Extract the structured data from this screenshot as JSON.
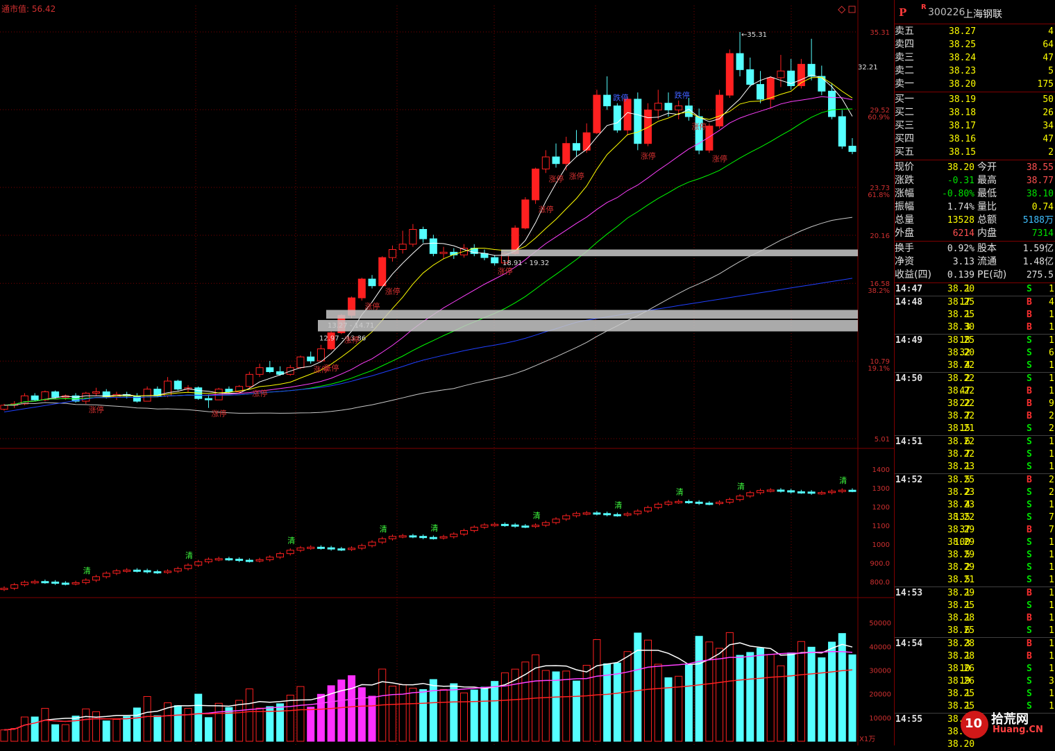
{
  "header": {
    "cap_label": "通市值:",
    "cap_value": "56.42"
  },
  "stock": {
    "p_mark": "P",
    "r_mark": "R",
    "code": "300226",
    "name": "上海钢联"
  },
  "order_book": {
    "asks": [
      {
        "label": "卖五",
        "price": "38.27",
        "vol": "4"
      },
      {
        "label": "卖四",
        "price": "38.25",
        "vol": "64"
      },
      {
        "label": "卖三",
        "price": "38.24",
        "vol": "47"
      },
      {
        "label": "卖二",
        "price": "38.23",
        "vol": "5"
      },
      {
        "label": "卖一",
        "price": "38.20",
        "vol": "175"
      }
    ],
    "bids": [
      {
        "label": "买一",
        "price": "38.19",
        "vol": "50"
      },
      {
        "label": "买二",
        "price": "38.18",
        "vol": "26"
      },
      {
        "label": "买三",
        "price": "38.17",
        "vol": "34"
      },
      {
        "label": "买四",
        "price": "38.16",
        "vol": "47"
      },
      {
        "label": "买五",
        "price": "38.15",
        "vol": "2"
      }
    ]
  },
  "stats": [
    {
      "l1": "现价",
      "v1": "38.20",
      "c1": "#ffff00",
      "l2": "今开",
      "v2": "38.55",
      "c2": "#ff5050"
    },
    {
      "l1": "涨跌",
      "v1": "-0.31",
      "c1": "#00e000",
      "l2": "最高",
      "v2": "38.77",
      "c2": "#ff5050"
    },
    {
      "l1": "涨幅",
      "v1": "-0.80%",
      "c1": "#00e000",
      "l2": "最低",
      "v2": "38.10",
      "c2": "#00e000"
    },
    {
      "l1": "振幅",
      "v1": "1.74%",
      "c1": "#e0e0e0",
      "l2": "量比",
      "v2": "0.74",
      "c2": "#ffff00"
    },
    {
      "l1": "总量",
      "v1": "13528",
      "c1": "#ffff00",
      "l2": "总额",
      "v2": "5188万",
      "c2": "#40c0ff"
    },
    {
      "l1": "外盘",
      "v1": "6214",
      "c1": "#ff5050",
      "l2": "内盘",
      "v2": "7314",
      "c2": "#00e000"
    }
  ],
  "fund": [
    {
      "l1": "换手",
      "v1": "0.92%",
      "c1": "#e0e0e0",
      "l2": "股本",
      "v2": "1.59亿",
      "c2": "#e0e0e0"
    },
    {
      "l1": "净资",
      "v1": "3.13",
      "c1": "#e0e0e0",
      "l2": "流通",
      "v2": "1.48亿",
      "c2": "#e0e0e0"
    },
    {
      "l1": "收益(四)",
      "v1": "0.139",
      "c1": "#e0e0e0",
      "l2": "PE(动)",
      "v2": "275.5",
      "c2": "#e0e0e0"
    }
  ],
  "ticks": [
    {
      "t": "14:47",
      "p": "38.20",
      "v": "1",
      "s": "S",
      "c": "1"
    },
    {
      "t": "14:48",
      "p": "38.25",
      "v": "17",
      "s": "B",
      "c": "4"
    },
    {
      "t": "",
      "p": "38.25",
      "v": "1",
      "s": "B",
      "c": "1"
    },
    {
      "t": "",
      "p": "38.30",
      "v": "3",
      "s": "B",
      "c": "1"
    },
    {
      "t": "14:49",
      "p": "38.25",
      "v": "18",
      "s": "S",
      "c": "1"
    },
    {
      "t": "",
      "p": "38.20",
      "v": "32",
      "s": "S",
      "c": "6"
    },
    {
      "t": "",
      "p": "38.22",
      "v": "4",
      "s": "S",
      "c": "1"
    },
    {
      "t": "14:50",
      "p": "38.22",
      "v": "2",
      "s": "S",
      "c": "1"
    },
    {
      "t": "",
      "p": "38.22",
      "v": "47",
      "s": "B",
      "c": "1"
    },
    {
      "t": "",
      "p": "38.22",
      "v": "22",
      "s": "B",
      "c": "9"
    },
    {
      "t": "",
      "p": "38.22",
      "v": "7",
      "s": "B",
      "c": "2"
    },
    {
      "t": "",
      "p": "38.21",
      "v": "15",
      "s": "S",
      "c": "2"
    },
    {
      "t": "14:51",
      "p": "38.22",
      "v": "6",
      "s": "S",
      "c": "1"
    },
    {
      "t": "",
      "p": "38.22",
      "v": "7",
      "s": "S",
      "c": "1"
    },
    {
      "t": "",
      "p": "38.23",
      "v": "1",
      "s": "S",
      "c": "1"
    },
    {
      "t": "14:52",
      "p": "38.25",
      "v": "5",
      "s": "B",
      "c": "2"
    },
    {
      "t": "",
      "p": "38.23",
      "v": "2",
      "s": "S",
      "c": "2"
    },
    {
      "t": "",
      "p": "38.23",
      "v": "4",
      "s": "S",
      "c": "1"
    },
    {
      "t": "",
      "p": "38.22",
      "v": "135",
      "s": "S",
      "c": "7"
    },
    {
      "t": "",
      "p": "38.29",
      "v": "37",
      "s": "B",
      "c": "7"
    },
    {
      "t": "",
      "p": "38.29",
      "v": "100",
      "s": "S",
      "c": "1"
    },
    {
      "t": "",
      "p": "38.29",
      "v": "5",
      "s": "S",
      "c": "1"
    },
    {
      "t": "",
      "p": "38.29",
      "v": "2",
      "s": "S",
      "c": "1"
    },
    {
      "t": "",
      "p": "38.21",
      "v": "5",
      "s": "S",
      "c": "1"
    },
    {
      "t": "14:53",
      "p": "38.29",
      "v": "1",
      "s": "B",
      "c": "1"
    },
    {
      "t": "",
      "p": "38.25",
      "v": "1",
      "s": "S",
      "c": "1"
    },
    {
      "t": "",
      "p": "38.28",
      "v": "1",
      "s": "B",
      "c": "1"
    },
    {
      "t": "",
      "p": "38.25",
      "v": "6",
      "s": "S",
      "c": "1"
    },
    {
      "t": "14:54",
      "p": "38.28",
      "v": "3",
      "s": "B",
      "c": "1"
    },
    {
      "t": "",
      "p": "38.28",
      "v": "1",
      "s": "B",
      "c": "1"
    },
    {
      "t": "",
      "p": "38.26",
      "v": "10",
      "s": "S",
      "c": "1"
    },
    {
      "t": "",
      "p": "38.26",
      "v": "19",
      "s": "S",
      "c": "3"
    },
    {
      "t": "",
      "p": "38.25",
      "v": "1",
      "s": "S",
      "c": "1"
    },
    {
      "t": "",
      "p": "38.25",
      "v": "1",
      "s": "S",
      "c": "1"
    },
    {
      "t": "14:55",
      "p": "38.25",
      "v": "",
      "s": "",
      "c": ""
    },
    {
      "t": "",
      "p": "38.27",
      "v": "",
      "s": "",
      "c": ""
    },
    {
      "t": "",
      "p": "38.20",
      "v": "",
      "s": "",
      "c": ""
    }
  ],
  "price_axis": {
    "labels": [
      "35.31",
      "32.21",
      "29.52",
      "60.9%",
      "23.73",
      "61.8%",
      "20.16",
      "16.58",
      "38.2%",
      "10.79",
      "19.1%",
      "5.01"
    ]
  },
  "ind_axis": {
    "labels": [
      "1400",
      "1300",
      "1200",
      "1100",
      "1000",
      "900.0",
      "800.0"
    ]
  },
  "vol_axis": {
    "labels": [
      "50000",
      "40000",
      "30000",
      "20000",
      "10000"
    ],
    "unit": "X1万"
  },
  "annotations": {
    "high_marker": "35.31",
    "zones": [
      "18.91 - 19.32",
      "13.27 - 14.71",
      "12.97 - 13.86"
    ],
    "limit_up": "涨停",
    "limit_down": "跌停",
    "clear": "清"
  },
  "colors": {
    "up": "#ff2020",
    "down": "#55ffff",
    "limit_down_fill": "#0000ff",
    "ma5": "#ffffff",
    "ma10": "#ffff00",
    "ma20": "#ff40ff",
    "ma30": "#00ff00",
    "ma60": "#c8c8c8",
    "ma120": "#2040ff",
    "grid": "#800000",
    "axis_text": "#d03030"
  },
  "chart_data": {
    "type": "candlestick",
    "price_range": [
      5.01,
      35.31
    ],
    "candles": [
      [
        7.2,
        7.6,
        7.1,
        7.5
      ],
      [
        7.5,
        7.8,
        7.3,
        7.6
      ],
      [
        7.6,
        8.4,
        7.5,
        8.2
      ],
      [
        8.2,
        8.4,
        7.8,
        7.9
      ],
      [
        7.9,
        8.6,
        7.8,
        8.5
      ],
      [
        8.5,
        8.6,
        8.0,
        8.1
      ],
      [
        8.1,
        8.3,
        7.9,
        8.2
      ],
      [
        8.2,
        8.4,
        7.7,
        7.8
      ],
      [
        7.8,
        8.5,
        7.6,
        8.4
      ],
      [
        8.4,
        8.8,
        8.2,
        8.5
      ],
      [
        8.5,
        8.7,
        8.0,
        8.1
      ],
      [
        8.1,
        8.5,
        7.9,
        8.3
      ],
      [
        8.3,
        8.5,
        8.0,
        8.2
      ],
      [
        8.2,
        8.4,
        7.7,
        7.8
      ],
      [
        7.8,
        8.9,
        7.8,
        8.7
      ],
      [
        8.7,
        8.9,
        8.1,
        8.2
      ],
      [
        8.2,
        9.6,
        8.1,
        9.3
      ],
      [
        9.3,
        9.4,
        8.6,
        8.7
      ],
      [
        8.7,
        9.0,
        8.5,
        8.8
      ],
      [
        8.8,
        8.9,
        7.9,
        8.0
      ],
      [
        8.0,
        8.3,
        7.3,
        7.9
      ],
      [
        7.9,
        8.8,
        7.9,
        8.7
      ],
      [
        8.7,
        8.9,
        8.4,
        8.5
      ],
      [
        8.5,
        9.0,
        8.4,
        8.9
      ],
      [
        8.9,
        10.0,
        8.8,
        9.8
      ],
      [
        9.8,
        10.6,
        9.6,
        10.3
      ],
      [
        10.3,
        10.8,
        9.9,
        10.0
      ],
      [
        10.0,
        10.4,
        9.7,
        9.8
      ],
      [
        9.8,
        10.5,
        9.7,
        10.3
      ],
      [
        10.3,
        11.2,
        10.2,
        11.1
      ],
      [
        11.1,
        11.5,
        10.6,
        10.8
      ],
      [
        10.8,
        12.0,
        10.7,
        11.7
      ],
      [
        11.7,
        13.0,
        11.6,
        12.9
      ],
      [
        12.9,
        14.3,
        12.8,
        14.2
      ],
      [
        14.2,
        15.6,
        14.0,
        15.5
      ],
      [
        15.5,
        17.0,
        15.3,
        16.9
      ],
      [
        16.9,
        17.2,
        16.2,
        16.4
      ],
      [
        16.4,
        18.6,
        16.4,
        18.5
      ],
      [
        18.5,
        19.4,
        18.2,
        19.1
      ],
      [
        19.1,
        20.5,
        18.8,
        19.5
      ],
      [
        19.5,
        21.0,
        19.3,
        20.6
      ],
      [
        20.6,
        20.8,
        19.6,
        19.9
      ],
      [
        19.9,
        20.2,
        18.6,
        18.8
      ],
      [
        18.8,
        19.3,
        18.4,
        18.9
      ],
      [
        18.9,
        19.2,
        18.4,
        18.7
      ],
      [
        18.7,
        19.5,
        18.5,
        19.2
      ],
      [
        19.2,
        19.5,
        18.6,
        18.8
      ],
      [
        18.8,
        19.1,
        18.3,
        18.5
      ],
      [
        18.5,
        18.7,
        17.9,
        18.1
      ],
      [
        18.1,
        18.9,
        18.0,
        18.8
      ],
      [
        18.8,
        20.9,
        18.7,
        20.7
      ],
      [
        20.7,
        23.0,
        20.6,
        22.8
      ],
      [
        22.8,
        25.2,
        22.5,
        25.1
      ],
      [
        25.1,
        26.5,
        24.8,
        26.0
      ],
      [
        26.0,
        27.0,
        25.2,
        25.5
      ],
      [
        25.5,
        27.5,
        25.0,
        27.0
      ],
      [
        27.0,
        28.0,
        26.0,
        26.5
      ],
      [
        26.5,
        28.5,
        26.3,
        27.8
      ],
      [
        27.8,
        31.0,
        27.7,
        30.6
      ],
      [
        30.6,
        32.0,
        29.5,
        29.8
      ],
      [
        29.8,
        30.0,
        27.8,
        28.0
      ],
      [
        28.0,
        30.5,
        27.6,
        30.3
      ],
      [
        30.3,
        30.8,
        26.5,
        27.0
      ],
      [
        27.0,
        30.0,
        26.8,
        29.5
      ],
      [
        29.5,
        31.0,
        28.8,
        30.0
      ],
      [
        30.0,
        30.8,
        29.0,
        29.5
      ],
      [
        29.5,
        30.2,
        28.8,
        29.8
      ],
      [
        29.8,
        30.4,
        28.7,
        29.0
      ],
      [
        29.0,
        29.6,
        26.2,
        26.5
      ],
      [
        26.5,
        28.5,
        26.3,
        28.3
      ],
      [
        28.3,
        31.0,
        28.1,
        30.6
      ],
      [
        30.6,
        34.0,
        30.4,
        33.7
      ],
      [
        33.7,
        35.31,
        32.0,
        32.5
      ],
      [
        32.5,
        33.4,
        31.2,
        31.4
      ],
      [
        31.4,
        32.4,
        30.0,
        30.3
      ],
      [
        30.3,
        32.0,
        29.6,
        31.9
      ],
      [
        31.9,
        33.6,
        31.2,
        32.4
      ],
      [
        32.4,
        33.3,
        31.0,
        31.3
      ],
      [
        31.3,
        33.3,
        31.1,
        32.9
      ],
      [
        32.9,
        34.8,
        31.7,
        32.0
      ],
      [
        32.0,
        32.8,
        30.6,
        30.9
      ],
      [
        30.9,
        31.5,
        28.8,
        29.0
      ],
      [
        29.0,
        29.5,
        26.6,
        26.8
      ],
      [
        26.8,
        27.4,
        26.2,
        26.4
      ]
    ],
    "volume_unit": "X1万",
    "volume_range": [
      0,
      55000
    ]
  }
}
